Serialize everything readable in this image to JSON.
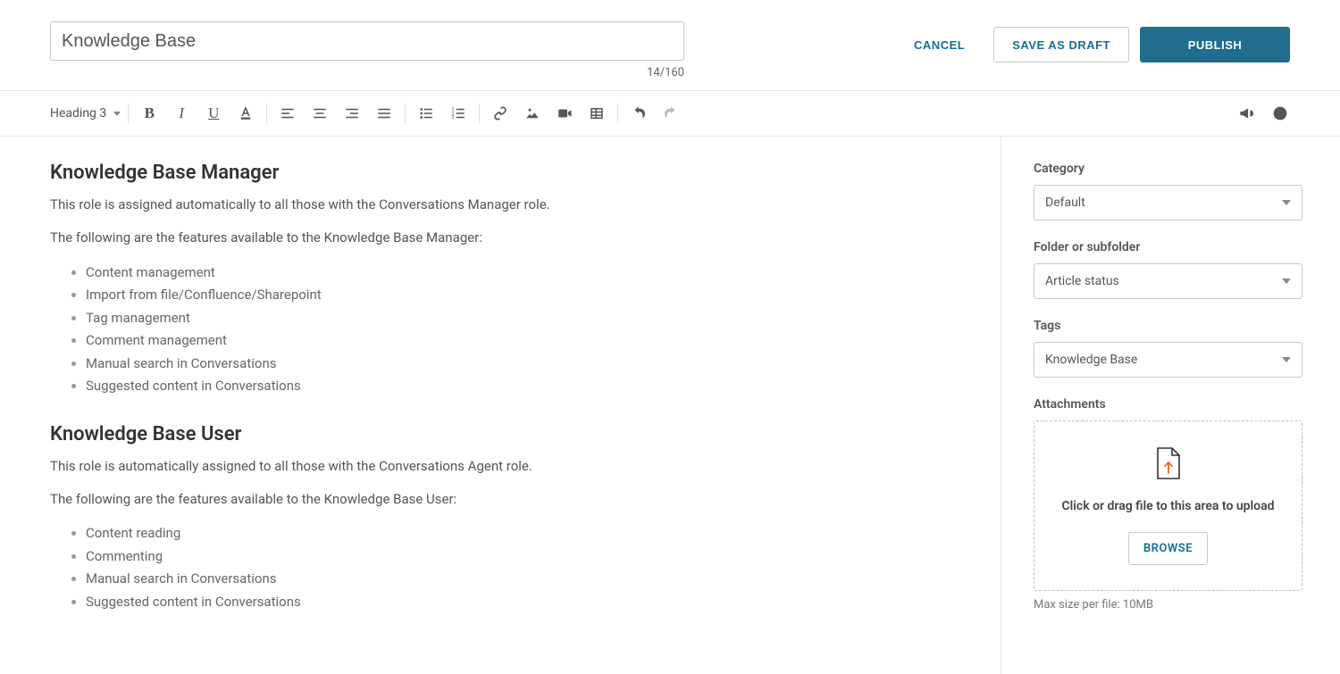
{
  "header": {
    "title_value": "Knowledge Base",
    "title_count": "14/160",
    "cancel_label": "CANCEL",
    "draft_label": "SAVE AS DRAFT",
    "publish_label": "PUBLISH"
  },
  "toolbar": {
    "heading_label": "Heading 3"
  },
  "content": {
    "h1": "Knowledge Base Manager",
    "p1": "This role is assigned automatically to all those with the Conversations Manager role.",
    "p2": "The following are the features available to the Knowledge Base Manager:",
    "list1": [
      "Content management",
      "Import from file/Confluence/Sharepoint",
      "Tag management",
      "Comment management",
      "Manual search in Conversations",
      "Suggested content in Conversations"
    ],
    "h2": "Knowledge Base User",
    "p3": "This role is automatically assigned to all those with the Conversations Agent role.",
    "p4": "The following are the features available to the Knowledge Base User:",
    "list2": [
      "Content reading",
      "Commenting",
      "Manual search in Conversations",
      "Suggested content in Conversations"
    ]
  },
  "sidebar": {
    "category_label": "Category",
    "category_value": "Default",
    "folder_label": "Folder or subfolder",
    "folder_value": "Article status",
    "tags_label": "Tags",
    "tags_value": "Knowledge Base",
    "attach_label": "Attachments",
    "dropzone_text": "Click or drag file to this area to upload",
    "browse_label": "BROWSE",
    "maxsize": "Max size per file: 10MB"
  }
}
